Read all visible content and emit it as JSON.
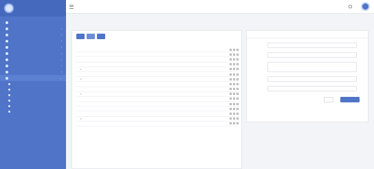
{
  "brand": {
    "name": ""
  },
  "topbar": {
    "user_name": "",
    "user_role": ""
  },
  "sidebar": {
    "items": [
      {
        "label": "",
        "active": false
      },
      {
        "label": "",
        "active": false
      },
      {
        "label": "",
        "active": false
      },
      {
        "label": "",
        "active": false
      },
      {
        "label": "",
        "active": false
      },
      {
        "label": "",
        "active": false
      },
      {
        "label": "",
        "active": false
      },
      {
        "label": "",
        "active": false
      },
      {
        "label": "",
        "active": false
      },
      {
        "label": "",
        "active": true
      }
    ],
    "subitems": [
      {
        "label": ""
      },
      {
        "label": ""
      },
      {
        "label": ""
      },
      {
        "label": ""
      },
      {
        "label": ""
      },
      {
        "label": ""
      }
    ]
  },
  "page": {
    "title": "",
    "subtitle": "",
    "breadcrumb": ""
  },
  "toolbar": {
    "btn1": "",
    "btn2": "",
    "btn3": "",
    "note": ""
  },
  "tree": {
    "rows": [
      {
        "label": "",
        "indent": 0,
        "toggle": ""
      },
      {
        "label": "",
        "indent": 0,
        "toggle": ""
      },
      {
        "label": "",
        "indent": 0,
        "toggle": ""
      },
      {
        "label": "",
        "indent": 0,
        "toggle": ""
      },
      {
        "label": "",
        "indent": 1,
        "toggle": "▾"
      },
      {
        "label": "",
        "indent": 2,
        "toggle": ""
      },
      {
        "label": "",
        "indent": 1,
        "toggle": "▾"
      },
      {
        "label": "",
        "indent": 2,
        "toggle": ""
      },
      {
        "label": "",
        "indent": 2,
        "toggle": ""
      },
      {
        "label": "",
        "indent": 1,
        "toggle": "▾"
      },
      {
        "label": "",
        "indent": 2,
        "toggle": ""
      },
      {
        "label": "",
        "indent": 2,
        "toggle": ""
      },
      {
        "label": "",
        "indent": 2,
        "toggle": ""
      },
      {
        "label": "",
        "indent": 2,
        "toggle": ""
      },
      {
        "label": "",
        "indent": 1,
        "toggle": "▾"
      },
      {
        "label": "",
        "indent": 2,
        "toggle": ""
      }
    ]
  },
  "form": {
    "title": "",
    "fields": [
      {
        "label": "",
        "value": ""
      },
      {
        "label": "",
        "value": ""
      },
      {
        "label": "",
        "value": ""
      },
      {
        "label": "",
        "value": ""
      },
      {
        "label": "",
        "value": ""
      }
    ],
    "hint": "",
    "cancel_label": "",
    "submit_label": ""
  },
  "colors": {
    "accent": "#4f74c8",
    "sidebar": "#4f74c8"
  }
}
